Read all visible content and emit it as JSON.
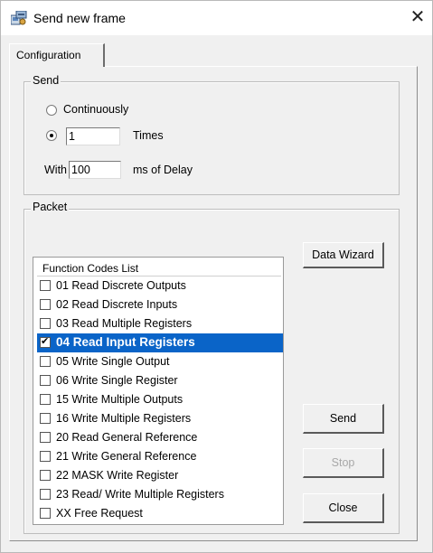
{
  "window": {
    "title": "Send new frame",
    "close_symbol": "✕"
  },
  "tabs": [
    {
      "label": "Configuration"
    }
  ],
  "send_group": {
    "legend": "Send",
    "continuously_label": "Continuously",
    "times_value": "1",
    "times_label": "Times",
    "with_label": "With",
    "delay_value": "100",
    "delay_label": "ms of Delay",
    "selected_mode": "times"
  },
  "packet_group": {
    "legend": "Packet",
    "list_header": "Function Codes List",
    "items": [
      {
        "label": "01 Read Discrete Outputs",
        "checked": false,
        "selected": false
      },
      {
        "label": "02 Read Discrete Inputs",
        "checked": false,
        "selected": false
      },
      {
        "label": "03 Read Multiple Registers",
        "checked": false,
        "selected": false
      },
      {
        "label": "04 Read Input Registers",
        "checked": true,
        "selected": true
      },
      {
        "label": "05 Write Single Output",
        "checked": false,
        "selected": false
      },
      {
        "label": "06 Write Single Register",
        "checked": false,
        "selected": false
      },
      {
        "label": "15 Write Multiple Outputs",
        "checked": false,
        "selected": false
      },
      {
        "label": "16 Write Multiple Registers",
        "checked": false,
        "selected": false
      },
      {
        "label": "20 Read General Reference",
        "checked": false,
        "selected": false
      },
      {
        "label": "21 Write General Reference",
        "checked": false,
        "selected": false
      },
      {
        "label": "22 MASK Write Register",
        "checked": false,
        "selected": false
      },
      {
        "label": "23 Read/ Write Multiple Registers",
        "checked": false,
        "selected": false
      },
      {
        "label": "XX Free Request",
        "checked": false,
        "selected": false
      }
    ]
  },
  "buttons": {
    "data_wizard": "Data Wizard",
    "send": "Send",
    "stop": "Stop",
    "close": "Close"
  }
}
